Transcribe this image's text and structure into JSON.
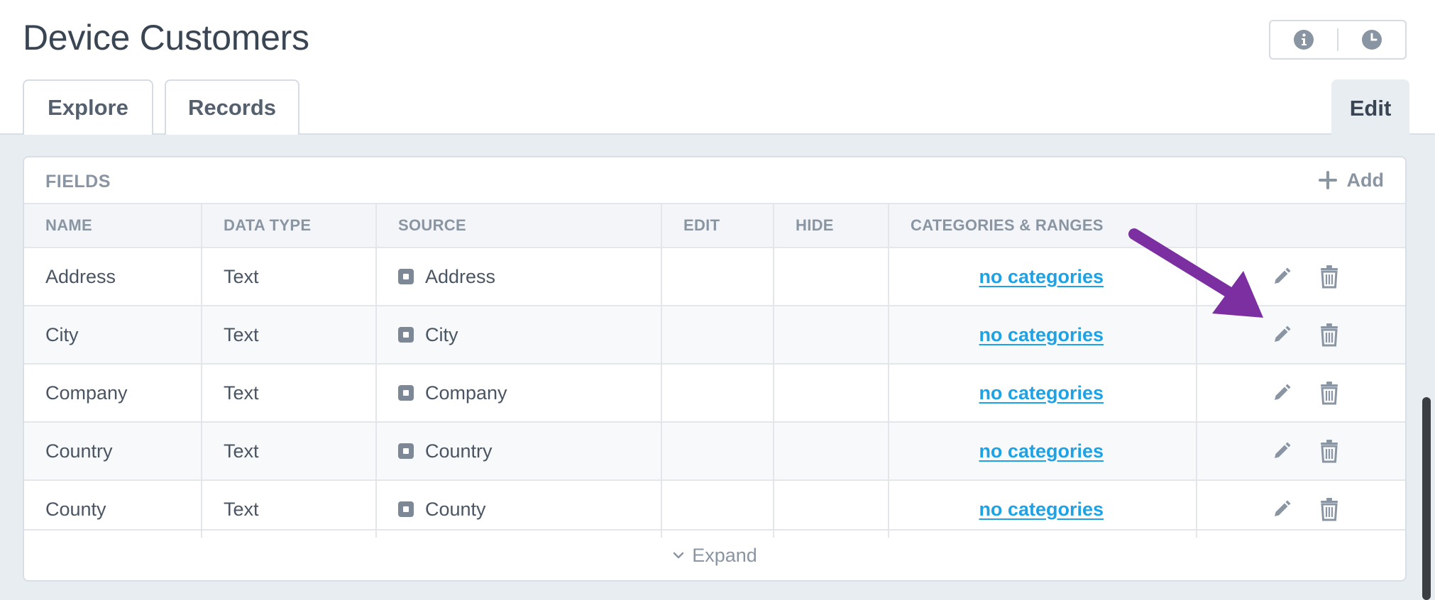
{
  "page": {
    "title": "Device Customers"
  },
  "tabs": {
    "explore": "Explore",
    "records": "Records",
    "edit": "Edit"
  },
  "header_icons": [
    "info-icon",
    "clock-icon"
  ],
  "fields": {
    "label": "FIELDS",
    "add_label": "Add",
    "columns": [
      "NAME",
      "DATA TYPE",
      "SOURCE",
      "EDIT",
      "HIDE",
      "CATEGORIES & RANGES",
      ""
    ],
    "rows": [
      {
        "name": "Address",
        "type": "Text",
        "source": "Address",
        "categories": "no categories"
      },
      {
        "name": "City",
        "type": "Text",
        "source": "City",
        "categories": "no categories"
      },
      {
        "name": "Company",
        "type": "Text",
        "source": "Company",
        "categories": "no categories"
      },
      {
        "name": "Country",
        "type": "Text",
        "source": "Country",
        "categories": "no categories"
      },
      {
        "name": "County",
        "type": "Text",
        "source": "County",
        "categories": "no categories"
      }
    ],
    "expand_label": "Expand"
  },
  "colors": {
    "link": "#1ea2e6",
    "annotation_arrow": "#7b2fa0",
    "muted": "#8a95a3"
  }
}
